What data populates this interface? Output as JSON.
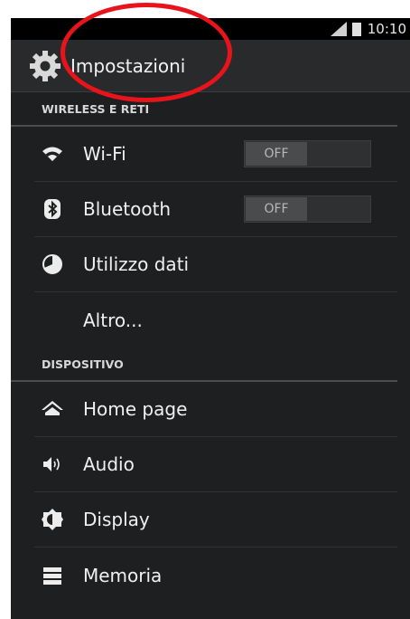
{
  "status": {
    "time": "10:10"
  },
  "header": {
    "title": "Impostazioni",
    "icon": "gear-icon"
  },
  "sections": [
    {
      "title": "WIRELESS E RETI",
      "items": [
        {
          "label": "Wi-Fi",
          "icon": "wifi-icon",
          "toggle": "OFF"
        },
        {
          "label": "Bluetooth",
          "icon": "bluetooth-icon",
          "toggle": "OFF"
        },
        {
          "label": "Utilizzo dati",
          "icon": "data-usage-icon"
        },
        {
          "label": "Altro..."
        }
      ]
    },
    {
      "title": "DISPOSITIVO",
      "items": [
        {
          "label": "Home page",
          "icon": "home-icon"
        },
        {
          "label": "Audio",
          "icon": "speaker-icon"
        },
        {
          "label": "Display",
          "icon": "brightness-icon"
        },
        {
          "label": "Memoria",
          "icon": "storage-icon"
        }
      ]
    }
  ],
  "colors": {
    "background": "#1d1f21",
    "annotation": "#e8141c"
  }
}
